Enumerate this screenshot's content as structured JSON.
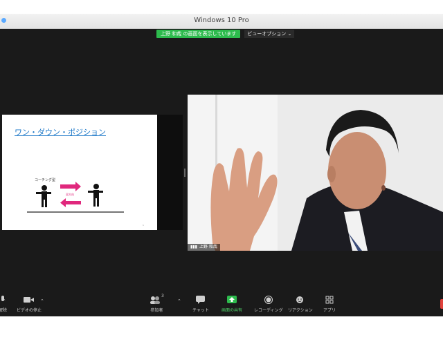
{
  "window": {
    "title": "Windows 10 Pro"
  },
  "share_banner": {
    "status": "上野 和哉 の画面を表示しています",
    "view_options": "ビューオプション ⌄"
  },
  "slide": {
    "title": "ワン・ダウン・ポジション",
    "label_top": "コーチング型",
    "label_mid": "双方向",
    "page_no": "1"
  },
  "video": {
    "name": "上野 和哉"
  },
  "toolbar": {
    "items": [
      {
        "label": "解除"
      },
      {
        "label": "ビデオの停止"
      },
      {
        "label": "参加者",
        "count": "3"
      },
      {
        "label": "チャット"
      },
      {
        "label": "画面の共有"
      },
      {
        "label": "レコーディング"
      },
      {
        "label": "リアクション"
      },
      {
        "label": "アプリ"
      }
    ]
  },
  "colors": {
    "accent_green": "#2dbb4d",
    "slide_title_blue": "#1d78c8",
    "arrow_pink": "#e0287d"
  }
}
